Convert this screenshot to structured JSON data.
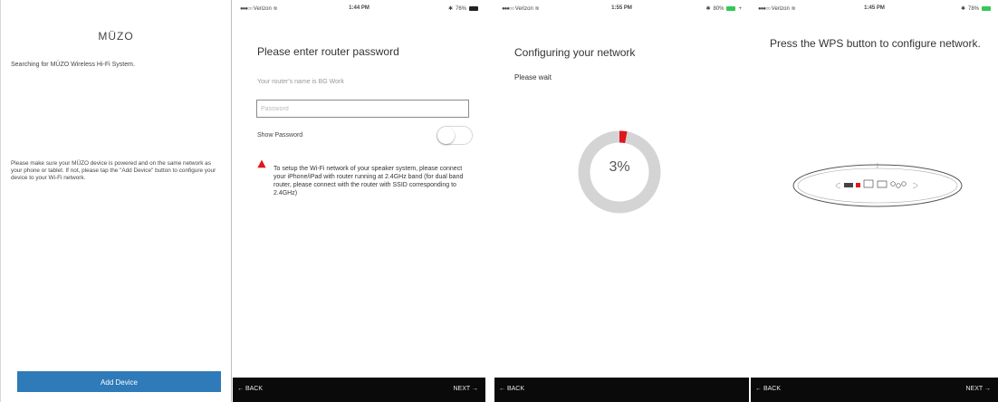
{
  "screen1": {
    "title": "MÜZO",
    "search_text": "Searching for MÜZO Wireless Hi-Fi System.",
    "note": "Please make sure your MÜZO device is powered and on the same network as your phone or tablet.  If not, please tap the \"Add Device\" button to configure your device to your Wi-Fi network.",
    "add_button": "Add Device"
  },
  "screen2": {
    "status": {
      "carrier": "Verizon",
      "time": "1:44 PM",
      "battery": "76%"
    },
    "title": "Please enter router password",
    "router_name": "Your router's name is BG Work",
    "password_placeholder": "Password",
    "show_password": "Show Password",
    "warning": "To setup the Wi-Fi network of your speaker system, please connect your iPhone/iPad with router running at 2.4GHz band (for dual band router, please connect with the router with SSID corresponding to 2.4GHz)",
    "back": "← BACK",
    "next": "NEXT →"
  },
  "screen3": {
    "status": {
      "carrier": "Verizon",
      "time": "1:55 PM",
      "battery": "80%"
    },
    "title": "Configuring your network",
    "wait": "Please wait",
    "progress_percent": 3,
    "progress_label": "3%",
    "back": "← BACK",
    "accent": "#e0161c"
  },
  "screen4": {
    "status": {
      "carrier": "Verizon",
      "time": "1:45 PM",
      "battery": "78%"
    },
    "title": "Press the WPS button to configure network.",
    "back": "← BACK",
    "next": "NEXT →"
  },
  "colors": {
    "button_blue": "#2f7ab8",
    "bar_black": "#0a0a0a",
    "warning_red": "#e0161c"
  }
}
